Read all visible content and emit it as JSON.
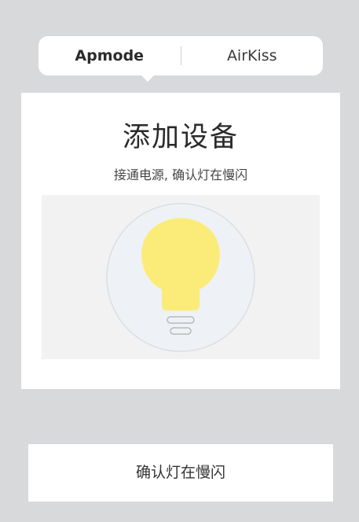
{
  "tabs": [
    {
      "label": "Apmode",
      "active": true
    },
    {
      "label": "AirKiss",
      "active": false
    }
  ],
  "card": {
    "title": "添加设备",
    "subtitle": "接通电源, 确认灯在慢闪",
    "illustration_icon": "lightbulb-icon"
  },
  "confirm_button": {
    "label": "确认灯在慢闪"
  },
  "colors": {
    "background": "#d8d9da",
    "panel": "#ffffff",
    "illustration_bg": "#f2f2f2",
    "bulb": "#fbec79",
    "circle": "#eef1f5"
  }
}
